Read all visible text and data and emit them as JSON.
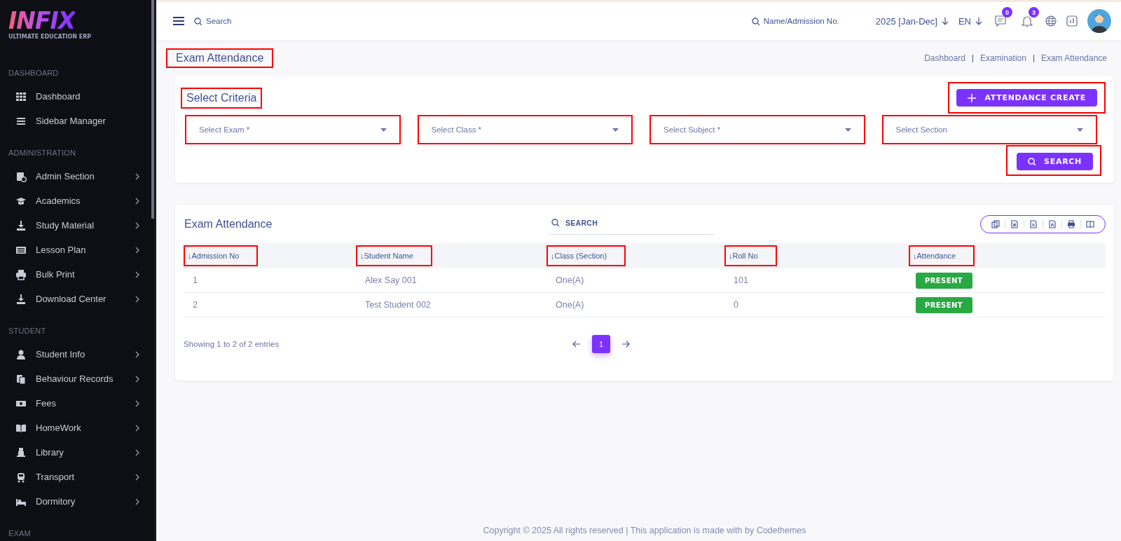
{
  "brand": {
    "logo": "INFIX",
    "tagline": "ULTIMATE EDUCATION ERP"
  },
  "sidebar": {
    "sections": [
      {
        "title": "DASHBOARD",
        "items": [
          {
            "label": "Dashboard",
            "expandable": false
          },
          {
            "label": "Sidebar Manager",
            "expandable": false
          }
        ]
      },
      {
        "title": "ADMINISTRATION",
        "items": [
          {
            "label": "Admin Section",
            "expandable": true
          },
          {
            "label": "Academics",
            "expandable": true
          },
          {
            "label": "Study Material",
            "expandable": true
          },
          {
            "label": "Lesson Plan",
            "expandable": true
          },
          {
            "label": "Bulk Print",
            "expandable": true
          },
          {
            "label": "Download Center",
            "expandable": true
          }
        ]
      },
      {
        "title": "STUDENT",
        "items": [
          {
            "label": "Student Info",
            "expandable": true
          },
          {
            "label": "Behaviour Records",
            "expandable": true
          },
          {
            "label": "Fees",
            "expandable": true
          },
          {
            "label": "HomeWork",
            "expandable": true
          },
          {
            "label": "Library",
            "expandable": true
          },
          {
            "label": "Transport",
            "expandable": true
          },
          {
            "label": "Dormitory",
            "expandable": true
          }
        ]
      },
      {
        "title": "EXAM"
      }
    ]
  },
  "topbar": {
    "search_placeholder": "Search",
    "student_search_placeholder": "Name/Admission No.",
    "session": "2025 [Jan-Dec]",
    "language": "EN",
    "message_count": "0",
    "notification_count": "3"
  },
  "page": {
    "title": "Exam Attendance",
    "title_highlighted": true,
    "breadcrumb": [
      "Dashboard",
      "Examination",
      "Exam Attendance"
    ]
  },
  "criteria": {
    "title": "Select Criteria",
    "title_highlighted": true,
    "create_button": {
      "label": "ATTENDANCE CREATE",
      "highlighted": true
    },
    "selects": [
      {
        "placeholder": "Select Exam *",
        "highlighted": true
      },
      {
        "placeholder": "Select Class *",
        "highlighted": true
      },
      {
        "placeholder": "Select Subject *",
        "highlighted": true
      },
      {
        "placeholder": "Select Section",
        "highlighted": true
      }
    ],
    "search_button": {
      "label": "SEARCH",
      "highlighted": true
    }
  },
  "table": {
    "title": "Exam Attendance",
    "search_placeholder": "SEARCH",
    "columns": [
      {
        "label": "↓Admission No",
        "highlighted": true
      },
      {
        "label": "↓Student Name",
        "highlighted": true
      },
      {
        "label": "↓Class (Section)",
        "highlighted": true
      },
      {
        "label": "↓Roll No",
        "highlighted": true
      },
      {
        "label": "↓Attendance",
        "highlighted": true
      }
    ],
    "rows": [
      {
        "admission_no": "1",
        "student_name": "Alex Say 001",
        "class_section": "One(A)",
        "roll_no": "101",
        "attendance": "PRESENT"
      },
      {
        "admission_no": "2",
        "student_name": "Test Student 002",
        "class_section": "One(A)",
        "roll_no": "0",
        "attendance": "PRESENT"
      }
    ],
    "info": "Showing 1 to 2 of 2 entries",
    "pages": [
      {
        "label": "1",
        "selected": true
      }
    ]
  },
  "footer": "Copyright © 2025 All rights reserved | This application is made with by Codethemes"
}
